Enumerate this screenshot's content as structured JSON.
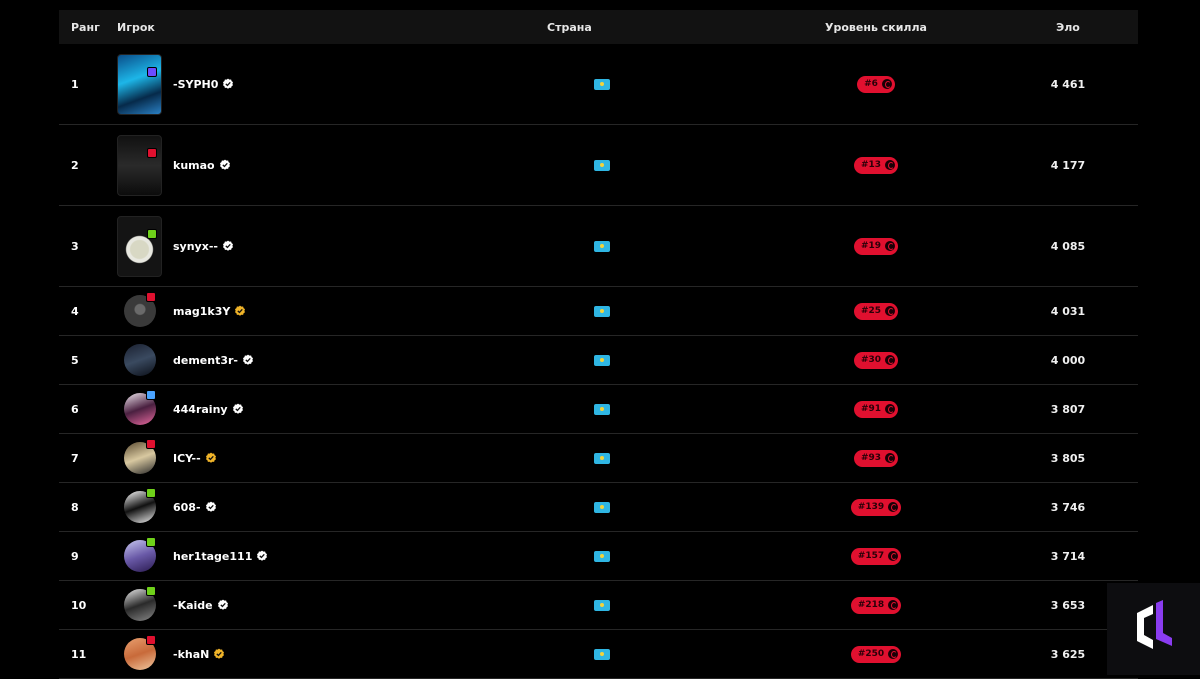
{
  "header": {
    "rank": "Ранг",
    "player": "Игрок",
    "country": "Страна",
    "skill": "Уровень скилла",
    "elo": "Эло"
  },
  "rows": [
    {
      "rank": "1",
      "name": "-SYPH0",
      "skill": "#6",
      "elo": "4 461",
      "verified": "white",
      "level_color": "#6b4cff",
      "avatar": "card"
    },
    {
      "rank": "2",
      "name": "kumao",
      "skill": "#13",
      "elo": "4 177",
      "verified": "white",
      "level_color": "#e0102f",
      "avatar": "card"
    },
    {
      "rank": "3",
      "name": "synyx--",
      "skill": "#19",
      "elo": "4 085",
      "verified": "white",
      "level_color": "#6fd11a",
      "avatar": "card"
    },
    {
      "rank": "4",
      "name": "mag1k3Y",
      "skill": "#25",
      "elo": "4 031",
      "verified": "gold",
      "level_color": "#e0102f",
      "avatar": "circle"
    },
    {
      "rank": "5",
      "name": "dement3r-",
      "skill": "#30",
      "elo": "4 000",
      "verified": "white",
      "level_color": "",
      "avatar": "circle"
    },
    {
      "rank": "6",
      "name": "444rainy",
      "skill": "#91",
      "elo": "3 807",
      "verified": "white",
      "level_color": "#4aa3ff",
      "avatar": "circle"
    },
    {
      "rank": "7",
      "name": "ICY--",
      "skill": "#93",
      "elo": "3 805",
      "verified": "gold",
      "level_color": "#e0102f",
      "avatar": "circle"
    },
    {
      "rank": "8",
      "name": "608-",
      "skill": "#139",
      "elo": "3 746",
      "verified": "white",
      "level_color": "#6fd11a",
      "avatar": "circle"
    },
    {
      "rank": "9",
      "name": "her1tage111",
      "skill": "#157",
      "elo": "3 714",
      "verified": "white",
      "level_color": "#6fd11a",
      "avatar": "circle"
    },
    {
      "rank": "10",
      "name": "-Kaide",
      "skill": "#218",
      "elo": "3 653",
      "verified": "white",
      "level_color": "#6fd11a",
      "avatar": "circle"
    },
    {
      "rank": "11",
      "name": "-khaN",
      "skill": "#250",
      "elo": "3 625",
      "verified": "gold",
      "level_color": "#e0102f",
      "avatar": "circle"
    }
  ],
  "colors": {
    "accent_red": "#e0102f",
    "header_bg": "#121212",
    "background": "#000000",
    "flag_blue": "#2fb6e3",
    "flag_yellow": "#f2d33b",
    "verified_gold": "#f0b429"
  }
}
